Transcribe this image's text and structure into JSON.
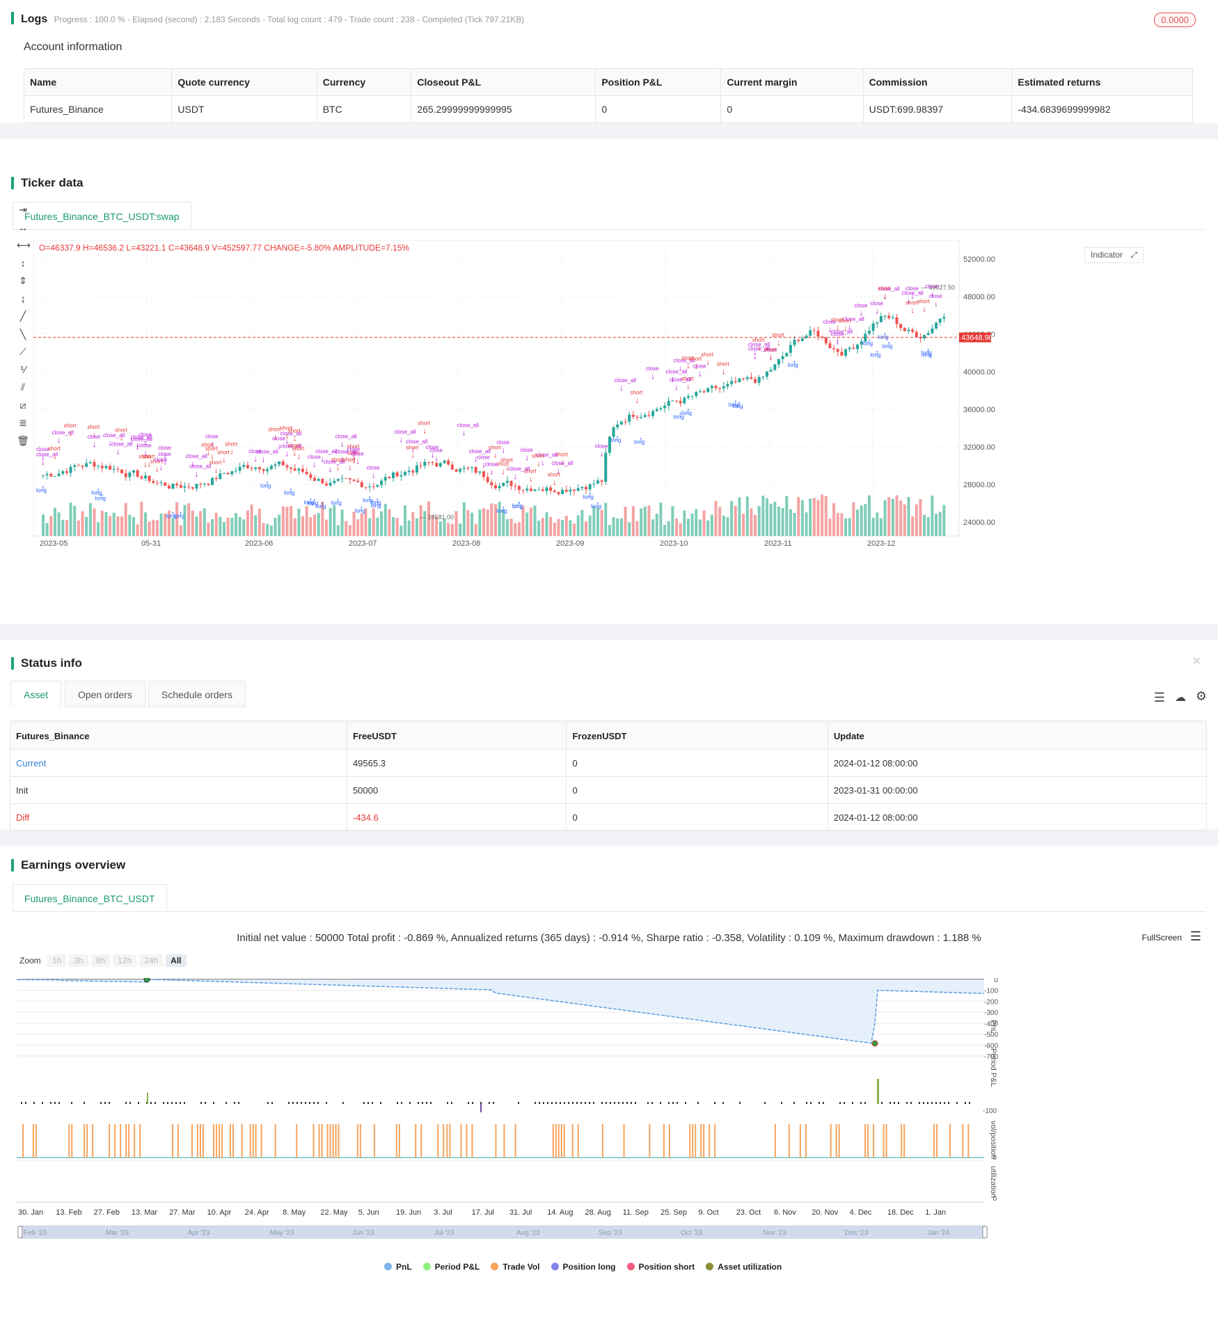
{
  "logs": {
    "title": "Logs",
    "progress": "Progress : 100.0 % - Elapsed (second) : 2.183  Seconds - Total log count : 479 - Trade count : 238 - Completed (Tick 797.21KB)",
    "badge": "0.0000"
  },
  "account": {
    "heading": "Account information",
    "columns": [
      "Name",
      "Quote currency",
      "Currency",
      "Closeout P&L",
      "Position P&L",
      "Current margin",
      "Commission",
      "Estimated returns"
    ],
    "row": [
      "Futures_Binance",
      "USDT",
      "BTC",
      "265.29999999999995",
      "0",
      "0",
      "USDT:699.98397",
      "-434.6839699999982"
    ]
  },
  "ticker": {
    "title": "Ticker data",
    "tab": "Futures_Binance_BTC_USDT:swap",
    "ohlc": "O=46337.9 H=46536.2 L=43221.1 C=43648.9 V=452597.77",
    "change": "CHANGE=-5.80%",
    "amplitude": "AMPLITUDE=7.15%",
    "indicator_btn": "Indicator",
    "last_price": "43648.90",
    "high_marker": "49027.50",
    "low_marker": "24581.00",
    "y_ticks": [
      "52000.00",
      "48000.00",
      "44000.00",
      "40000.00",
      "36000.00",
      "32000.00",
      "28000.00",
      "24000.00"
    ],
    "x_ticks": [
      "2023-05",
      "05-31",
      "2023-06",
      "2023-07",
      "2023-08",
      "2023-09",
      "2023-10",
      "2023-11",
      "2023-12"
    ],
    "colors": {
      "up": "#26a69a",
      "down": "#ef5350",
      "long": "#2962ff",
      "short": "#e53935",
      "close": "#b71cdc"
    }
  },
  "status": {
    "title": "Status info",
    "tabs": [
      "Asset",
      "Open orders",
      "Schedule orders"
    ],
    "columns": [
      "Futures_Binance",
      "FreeUSDT",
      "FrozenUSDT",
      "Update"
    ],
    "rows": [
      [
        "Current",
        "49565.3",
        "0",
        "2024-01-12 08:00:00"
      ],
      [
        "Init",
        "50000",
        "0",
        "2023-01-31 00:00:00"
      ],
      [
        "Diff",
        "-434.6",
        "0",
        "2024-01-12 08:00:00"
      ]
    ]
  },
  "earnings": {
    "title": "Earnings overview",
    "tab": "Futures_Binance_BTC_USDT",
    "summary": "Initial net value : 50000  Total profit : -0.869 %, Annualized returns (365 days) : -0.914 %, Sharpe ratio : -0.358, Volatility : 0.109 %, Maximum drawdown : 1.188 %",
    "fullscreen": "FullScreen",
    "zoom_label": "Zoom",
    "zoom": [
      "1h",
      "3h",
      "8h",
      "12h",
      "24h",
      "All"
    ],
    "pnl_ticks": [
      "0",
      "-100",
      "-200",
      "-300",
      "-400",
      "-500",
      "-600",
      "-700"
    ],
    "axis_labels": [
      "PnL",
      "Period P&L",
      "vol/position",
      "utilization"
    ],
    "period_tick": "-100",
    "vol_tick": "0",
    "util_tick": "0",
    "x_ticks": [
      "30. Jan",
      "13. Feb",
      "27. Feb",
      "13. Mar",
      "27. Mar",
      "10. Apr",
      "24. Apr",
      "8. May",
      "22. May",
      "5. Jun",
      "19. Jun",
      "3. Jul",
      "17. Jul",
      "31. Jul",
      "14. Aug",
      "28. Aug",
      "11. Sep",
      "25. Sep",
      "9. Oct",
      "23. Oct",
      "6. Nov",
      "20. Nov",
      "4. Dec",
      "18. Dec",
      "1. Jan"
    ],
    "nav_ticks": [
      "Feb '23",
      "Mar '23",
      "Apr '23",
      "May '23",
      "Jun '23",
      "Jul '23",
      "Aug '23",
      "Sep '23",
      "Oct '23",
      "Nov '23",
      "Dec '23",
      "Jan '24"
    ],
    "legend": [
      {
        "label": "PnL",
        "color": "#7cb5ec"
      },
      {
        "label": "Period P&L",
        "color": "#90ed7d"
      },
      {
        "label": "Trade Vol",
        "color": "#f7a35c"
      },
      {
        "label": "Position long",
        "color": "#8085e9"
      },
      {
        "label": "Position short",
        "color": "#f15c80"
      },
      {
        "label": "Asset utilization",
        "color": "#8d8d3a"
      }
    ]
  }
}
